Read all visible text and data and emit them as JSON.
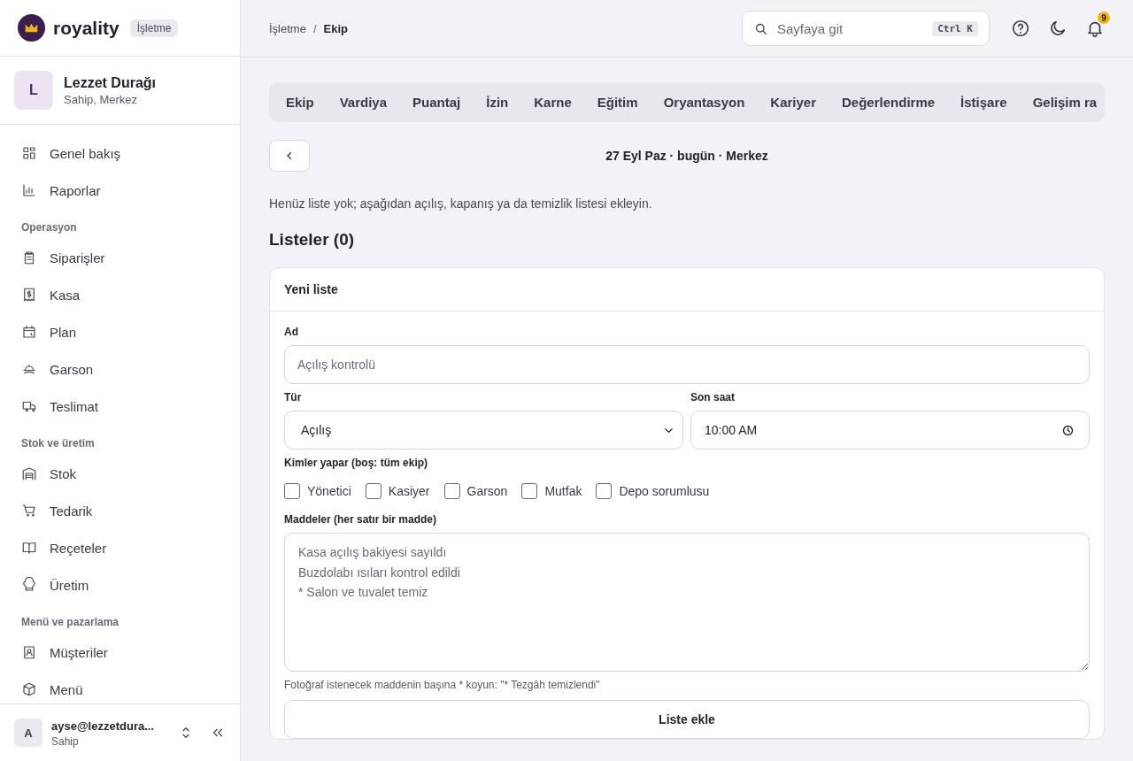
{
  "brand": {
    "name": "royality",
    "badge": "İşletme"
  },
  "account": {
    "initial": "L",
    "name": "Lezzet Durağı",
    "role": "Sahip, Merkez"
  },
  "sidebar": {
    "groups": [
      {
        "items": [
          {
            "label": "Genel bakış"
          },
          {
            "label": "Raporlar"
          }
        ]
      },
      {
        "title": "Operasyon",
        "items": [
          {
            "label": "Siparişler"
          },
          {
            "label": "Kasa"
          },
          {
            "label": "Plan"
          },
          {
            "label": "Garson"
          },
          {
            "label": "Teslimat"
          }
        ]
      },
      {
        "title": "Stok ve üretim",
        "items": [
          {
            "label": "Stok"
          },
          {
            "label": "Tedarik"
          },
          {
            "label": "Reçeteler"
          },
          {
            "label": "Üretim"
          }
        ]
      },
      {
        "title": "Menü ve pazarlama",
        "items": [
          {
            "label": "Müşteriler"
          },
          {
            "label": "Menü"
          }
        ]
      }
    ]
  },
  "user": {
    "initial": "A",
    "email": "ayse@lezzetdura...",
    "role": "Sahip"
  },
  "breadcrumb": [
    "İşletme",
    "/",
    "Ekip"
  ],
  "search": {
    "placeholder": "Sayfaya git",
    "shortcut": "Ctrl K"
  },
  "notifications": {
    "count": "9"
  },
  "tabs": [
    {
      "label": "Ekip",
      "selected": false
    },
    {
      "label": "Vardiya",
      "selected": false
    },
    {
      "label": "Puantaj",
      "selected": false
    },
    {
      "label": "İzin",
      "selected": false
    },
    {
      "label": "Karne",
      "selected": false
    },
    {
      "label": "Eğitim",
      "selected": false
    },
    {
      "label": "Oryantasyon",
      "selected": false
    },
    {
      "label": "Kariyer",
      "selected": false
    },
    {
      "label": "Değerlendirme",
      "selected": false
    },
    {
      "label": "İstişare",
      "selected": false
    },
    {
      "label": "Gelişim ra",
      "selected": false
    }
  ],
  "date_title": "27 Eyl Paz · bugün · Merkez",
  "empty_note": "Henüz liste yok; aşağıdan açılış, kapanış ya da temizlik listesi ekleyin.",
  "lists_heading": "Listeler (0)",
  "form": {
    "title": "Yeni liste",
    "name": {
      "label": "Ad",
      "placeholder": "Açılış kontrolü"
    },
    "type": {
      "label": "Tür",
      "value": "Açılış"
    },
    "deadline": {
      "label": "Son saat",
      "value": "10:00 AM"
    },
    "roles": {
      "label": "Kimler yapar (boş: tüm ekip)",
      "options": [
        {
          "label": "Yönetici",
          "checked": false
        },
        {
          "label": "Kasiyer",
          "checked": false
        },
        {
          "label": "Garson",
          "checked": false
        },
        {
          "label": "Mutfak",
          "checked": false
        },
        {
          "label": "Depo sorumlusu",
          "checked": false
        }
      ]
    },
    "items": {
      "label": "Maddeler (her satır bir madde)",
      "placeholder": "Kasa açılış bakiyesi sayıldı\nBuzdolabı ısıları kontrol edildi\n* Salon ve tuvalet temiz"
    },
    "hint": "Fotoğraf istenecek maddenin başına * koyun: \"* Tezgâh temizlendi\"",
    "submit": "Liste ekle"
  }
}
